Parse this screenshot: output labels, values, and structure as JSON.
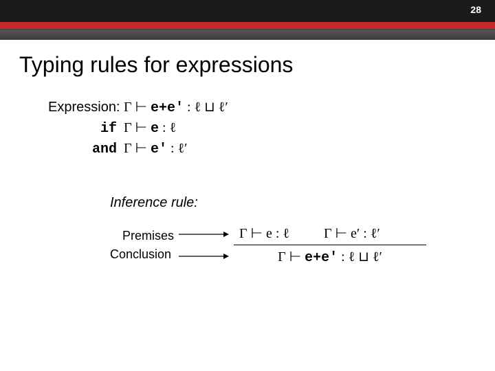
{
  "header": {
    "page_number": "28"
  },
  "title": "Typing rules for expressions",
  "expression_block": {
    "label": "Expression:",
    "line1": "Γ ⊢ e+e′ : ℓ ⊔ ℓ′",
    "if_kw": "if",
    "line2": "Γ ⊢ e : ℓ",
    "and_kw": "and",
    "line3": "Γ ⊢ e′ : ℓ′"
  },
  "inference": {
    "heading": "Inference rule:",
    "premises_label": "Premises",
    "conclusion_label": "Conclusion",
    "premise1": "Γ ⊢ e : ℓ",
    "premise2": "Γ ⊢ e′ : ℓ′",
    "conclusion": "Γ ⊢ e+e′ : ℓ ⊔ ℓ′"
  }
}
